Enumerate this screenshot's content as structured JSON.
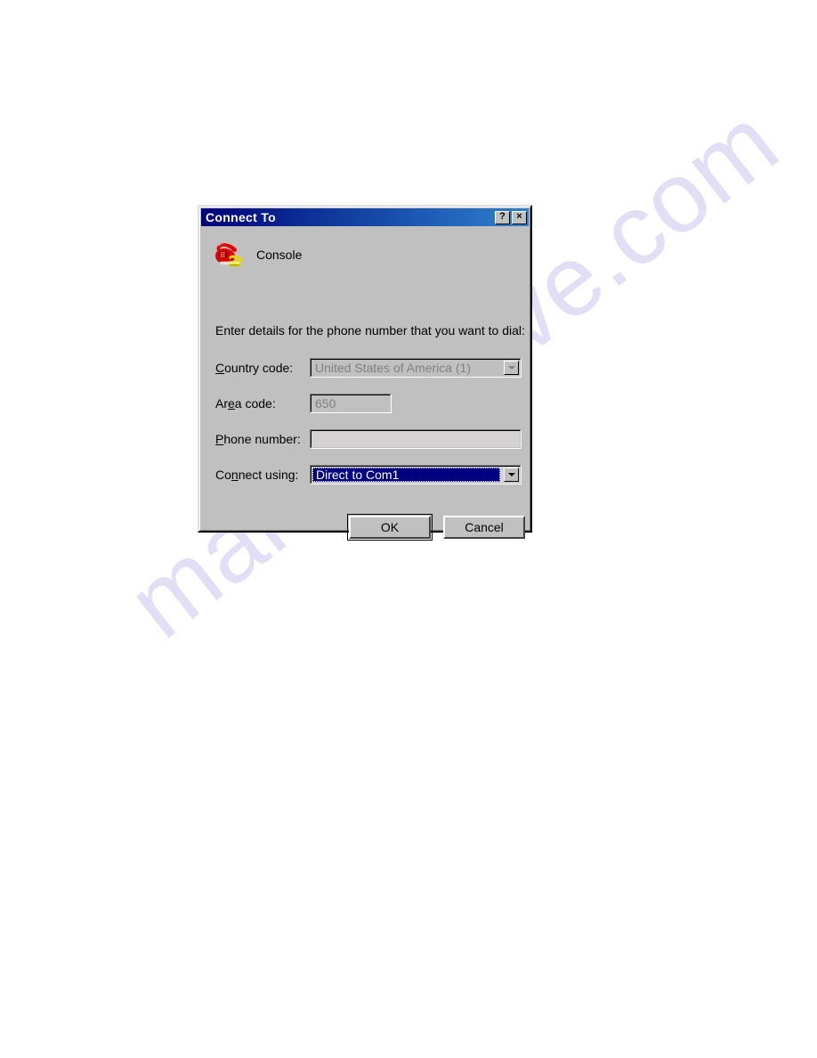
{
  "page": {
    "background_color": "#ffffff",
    "watermark_text": "manualshive.com"
  },
  "dialog": {
    "title": "Connect To",
    "face_color": "#c0c0c0",
    "titlebar_gradient_start": "#00007b",
    "titlebar_gradient_end": "#2f82cd",
    "titlebar_buttons": [
      {
        "name": "help",
        "label": "?"
      },
      {
        "name": "close",
        "label": "×"
      }
    ],
    "connection": {
      "icon": "dialup-phone-icon",
      "name": "Console"
    },
    "instruction": "Enter details for the phone number that you want to dial:",
    "fields": {
      "country": {
        "label_before": "C",
        "label_accel": "",
        "label_after": "ountry code:",
        "value": "United States of America (1)",
        "enabled": false,
        "control": "combobox"
      },
      "area": {
        "label_before": "Ar",
        "label_accel": "e",
        "label_after": "a code:",
        "value": "650",
        "enabled": false,
        "control": "textbox"
      },
      "phone": {
        "label_before": "",
        "label_accel": "P",
        "label_after": "hone number:",
        "value": "",
        "enabled": true,
        "control": "textbox"
      },
      "connect_using": {
        "label_before": "Co",
        "label_accel": "n",
        "label_after": "nect using:",
        "value": "Direct to Com1",
        "enabled": true,
        "selected": true,
        "control": "combobox",
        "highlight_color": "#000080"
      }
    },
    "buttons": {
      "ok": "OK",
      "cancel": "Cancel",
      "default": "ok"
    }
  }
}
